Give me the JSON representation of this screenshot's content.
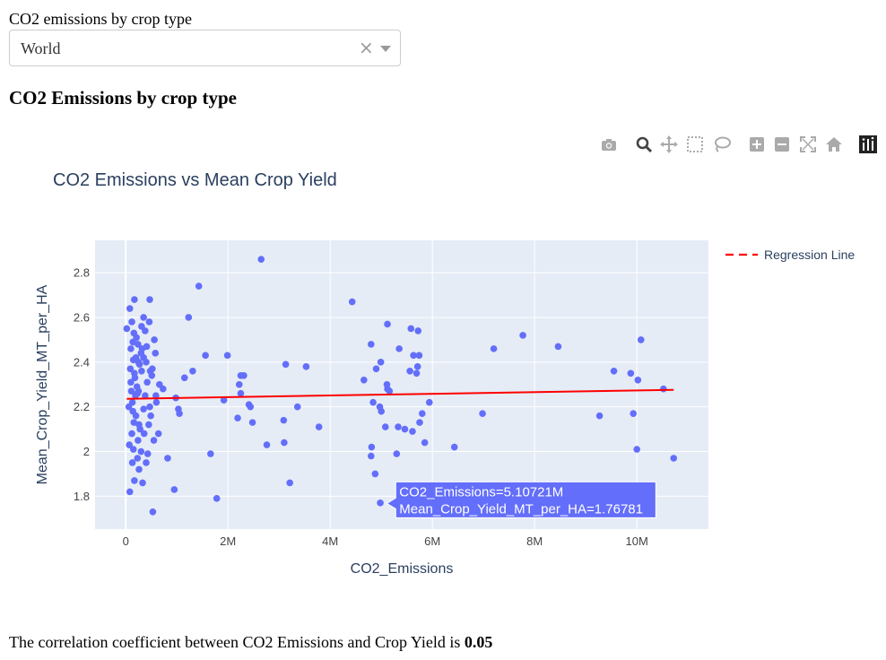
{
  "dropdown": {
    "label": "CO2 emissions by crop type",
    "value": "World",
    "clear_glyph": "×"
  },
  "heading": "CO2 Emissions by crop type",
  "modebar": {
    "icons": [
      "camera-icon",
      "zoom-icon",
      "pan-icon",
      "box-select-icon",
      "lasso-icon",
      "zoom-in-icon",
      "zoom-out-icon",
      "autoscale-icon",
      "reset-axes-icon",
      "plotly-logo-icon"
    ]
  },
  "footer": {
    "text": "The correlation coefficient between CO2 Emissions and Crop Yield is ",
    "value": "0.05"
  },
  "chart_data": {
    "type": "scatter",
    "title": "CO2 Emissions vs Mean Crop Yield",
    "xlabel": "CO2_Emissions",
    "ylabel": "Mean_Crop_Yield_MT_per_HA",
    "xlim": [
      -600000,
      11400000
    ],
    "ylim": [
      1.653,
      2.945
    ],
    "x_ticks": [
      0,
      2000000,
      4000000,
      6000000,
      8000000,
      10000000
    ],
    "x_tick_labels": [
      "0",
      "2M",
      "4M",
      "6M",
      "8M",
      "10M"
    ],
    "y_ticks": [
      1.8,
      2.0,
      2.2,
      2.4,
      2.6,
      2.8
    ],
    "y_tick_labels": [
      "1.8",
      "2",
      "2.2",
      "2.4",
      "2.6",
      "2.8"
    ],
    "grid": true,
    "legend_position": "top-right",
    "colors": {
      "points": "#636efa",
      "regression": "#ff0000",
      "plot_bg": "#e5ecf6",
      "tooltip_bg": "#636efa"
    },
    "series": [
      {
        "kind": "markers",
        "points": [
          [
            2650000,
            2.86
          ],
          [
            1430000,
            2.74
          ],
          [
            470000,
            2.68
          ],
          [
            170000,
            2.68
          ],
          [
            4430000,
            2.67
          ],
          [
            80000,
            2.64
          ],
          [
            1230000,
            2.6
          ],
          [
            350000,
            2.6
          ],
          [
            120000,
            2.58
          ],
          [
            460000,
            2.58
          ],
          [
            5120000,
            2.57
          ],
          [
            310000,
            2.56
          ],
          [
            5580000,
            2.55
          ],
          [
            20000,
            2.55
          ],
          [
            380000,
            2.54
          ],
          [
            5720000,
            2.54
          ],
          [
            160000,
            2.53
          ],
          [
            7770000,
            2.52
          ],
          [
            210000,
            2.51
          ],
          [
            10080000,
            2.5
          ],
          [
            560000,
            2.5
          ],
          [
            140000,
            2.49
          ],
          [
            4800000,
            2.48
          ],
          [
            240000,
            2.48
          ],
          [
            8460000,
            2.47
          ],
          [
            7200000,
            2.46
          ],
          [
            5350000,
            2.46
          ],
          [
            100000,
            2.46
          ],
          [
            3530000,
            2.38
          ],
          [
            3130000,
            2.39
          ],
          [
            1560000,
            2.43
          ],
          [
            1990000,
            2.43
          ],
          [
            5630000,
            2.43
          ],
          [
            5740000,
            2.43
          ],
          [
            350000,
            2.42
          ],
          [
            150000,
            2.41
          ],
          [
            250000,
            2.4
          ],
          [
            4990000,
            2.4
          ],
          [
            5710000,
            2.38
          ],
          [
            9550000,
            2.36
          ],
          [
            1310000,
            2.36
          ],
          [
            2250000,
            2.34
          ],
          [
            2310000,
            2.34
          ],
          [
            9880000,
            2.35
          ],
          [
            5690000,
            2.35
          ],
          [
            480000,
            2.36
          ],
          [
            5560000,
            2.36
          ],
          [
            170000,
            2.35
          ],
          [
            4900000,
            2.37
          ],
          [
            4660000,
            2.32
          ],
          [
            10020000,
            2.32
          ],
          [
            1150000,
            2.33
          ],
          [
            2220000,
            2.3
          ],
          [
            5110000,
            2.3
          ],
          [
            5120000,
            2.28
          ],
          [
            660000,
            2.3
          ],
          [
            10520000,
            2.28
          ],
          [
            730000,
            2.28
          ],
          [
            5160000,
            2.27
          ],
          [
            2250000,
            2.26
          ],
          [
            590000,
            2.25
          ],
          [
            230000,
            2.26
          ],
          [
            980000,
            2.24
          ],
          [
            1920000,
            2.23
          ],
          [
            130000,
            2.22
          ],
          [
            5940000,
            2.22
          ],
          [
            4840000,
            2.22
          ],
          [
            4970000,
            2.2
          ],
          [
            2410000,
            2.21
          ],
          [
            1030000,
            2.19
          ],
          [
            5800000,
            2.17
          ],
          [
            6980000,
            2.17
          ],
          [
            9930000,
            2.17
          ],
          [
            1050000,
            2.17
          ],
          [
            3360000,
            2.2
          ],
          [
            2440000,
            2.2
          ],
          [
            5000000,
            2.18
          ],
          [
            9270000,
            2.16
          ],
          [
            2190000,
            2.15
          ],
          [
            3090000,
            2.14
          ],
          [
            2480000,
            2.13
          ],
          [
            5750000,
            2.13
          ],
          [
            5080000,
            2.11
          ],
          [
            3780000,
            2.11
          ],
          [
            5330000,
            2.11
          ],
          [
            5460000,
            2.1
          ],
          [
            5610000,
            2.09
          ],
          [
            280000,
            2.1
          ],
          [
            640000,
            2.08
          ],
          [
            5850000,
            2.04
          ],
          [
            3100000,
            2.04
          ],
          [
            2760000,
            2.03
          ],
          [
            6430000,
            2.02
          ],
          [
            4810000,
            2.02
          ],
          [
            10000000,
            2.01
          ],
          [
            1660000,
            1.99
          ],
          [
            5300000,
            1.99
          ],
          [
            4800000,
            1.98
          ],
          [
            10720000,
            1.97
          ],
          [
            820000,
            1.97
          ],
          [
            4880000,
            1.9
          ],
          [
            3210000,
            1.86
          ],
          [
            950000,
            1.83
          ],
          [
            80000,
            1.82
          ],
          [
            1780000,
            1.79
          ],
          [
            4980000,
            1.77
          ],
          [
            530000,
            1.73
          ],
          [
            330000,
            1.86
          ],
          [
            170000,
            1.87
          ],
          [
            260000,
            1.92
          ],
          [
            400000,
            1.95
          ],
          [
            300000,
            2.0
          ],
          [
            550000,
            2.05
          ],
          [
            120000,
            2.08
          ],
          [
            450000,
            2.12
          ],
          [
            200000,
            2.16
          ],
          [
            350000,
            2.19
          ],
          [
            600000,
            2.22
          ],
          [
            250000,
            2.27
          ],
          [
            420000,
            2.31
          ],
          [
            180000,
            2.33
          ],
          [
            520000,
            2.37
          ],
          [
            300000,
            2.44
          ],
          [
            90000,
            2.37
          ],
          [
            220000,
            2.29
          ],
          [
            380000,
            2.25
          ],
          [
            60000,
            2.2
          ],
          [
            160000,
            2.13
          ],
          [
            430000,
            1.99
          ],
          [
            230000,
            1.97
          ],
          [
            70000,
            2.03
          ],
          [
            510000,
            2.34
          ],
          [
            320000,
            2.46
          ],
          [
            410000,
            2.47
          ],
          [
            110000,
            2.27
          ],
          [
            270000,
            2.39
          ],
          [
            150000,
            2.01
          ],
          [
            490000,
            2.16
          ],
          [
            360000,
            2.08
          ],
          [
            240000,
            2.05
          ],
          [
            200000,
            2.42
          ],
          [
            140000,
            2.18
          ],
          [
            310000,
            2.36
          ],
          [
            580000,
            2.44
          ],
          [
            470000,
            2.2
          ],
          [
            100000,
            2.31
          ],
          [
            190000,
            2.25
          ],
          [
            400000,
            2.4
          ],
          [
            260000,
            2.12
          ],
          [
            130000,
            1.95
          ]
        ]
      },
      {
        "name": "Regression Line",
        "kind": "line",
        "x": [
          20000,
          10720000
        ],
        "y": [
          2.236,
          2.276
        ]
      }
    ],
    "hover": {
      "x": 5107210,
      "y": 1.76781,
      "lines": [
        "CO2_Emissions=5.10721M",
        "Mean_Crop_Yield_MT_per_HA=1.76781"
      ]
    }
  }
}
